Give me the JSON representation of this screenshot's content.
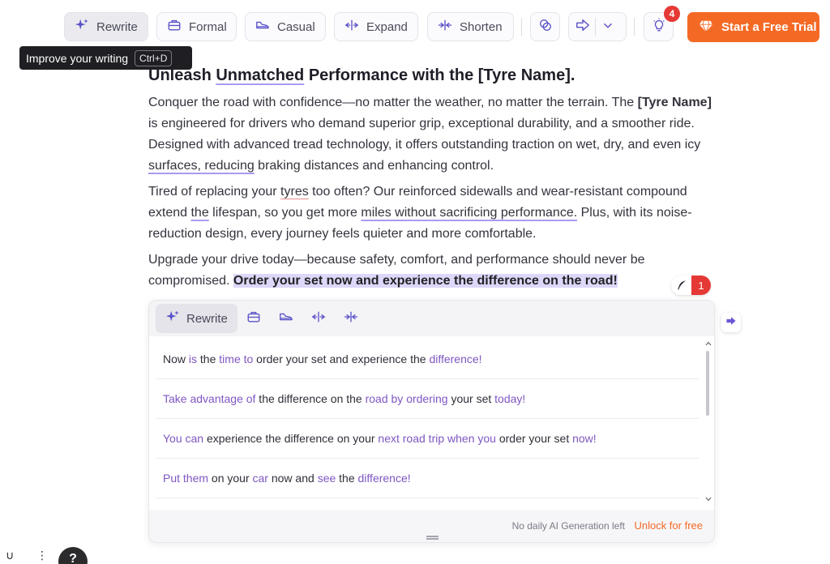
{
  "toolbar": {
    "rewrite_label": "Rewrite",
    "formal_label": "Formal",
    "casual_label": "Casual",
    "expand_label": "Expand",
    "shorten_label": "Shorten",
    "notification_count": "4",
    "trial_label": "Start a Free Trial"
  },
  "tooltip": {
    "text": "Improve your writing",
    "shortcut": "Ctrl+D"
  },
  "document": {
    "heading": {
      "part1": "Unleash ",
      "part2": "Unmatched",
      "part3": " Performance with the [Tyre Name]."
    },
    "para1": {
      "part1": "Conquer the road with confidence—no matter the weather, no matter the terrain. The ",
      "bold": "[Tyre Name]",
      "part2": " is engineered for drivers who demand superior grip, exceptional durability, and a smoother ride. Designed with advanced tread technology, it offers outstanding traction on wet, dry, and even icy ",
      "underlined": "surfaces, reducing",
      "part3": " braking distances and enhancing control."
    },
    "para2": {
      "part1": "Tired of replacing your ",
      "misspelled": "tyres",
      "part2": " too often? Our reinforced sidewalls and wear-resistant compound extend ",
      "underlined1": "the",
      "part3": " lifespan, so you get more ",
      "underlined2": "miles without sacrificing performance.",
      "part4": " Plus, with its noise-reduction design, every journey feels quieter and more comfortable."
    },
    "para3": {
      "part1": "Upgrade your drive today—because safety, comfort, and performance should never be compromised. ",
      "highlighted": "Order your set now and experience the difference on the road!"
    },
    "issue_count": "1"
  },
  "panel": {
    "rewrite_label": "Rewrite",
    "suggestions": [
      [
        {
          "t": "Now ",
          "h": false
        },
        {
          "t": "is",
          "h": true
        },
        {
          "t": " the ",
          "h": false
        },
        {
          "t": "time to",
          "h": true
        },
        {
          "t": " order your set and experience the ",
          "h": false
        },
        {
          "t": "difference!",
          "h": true
        }
      ],
      [
        {
          "t": "Take advantage of",
          "h": true
        },
        {
          "t": " the difference on the ",
          "h": false
        },
        {
          "t": "road by ordering",
          "h": true
        },
        {
          "t": " your set ",
          "h": false
        },
        {
          "t": "today!",
          "h": true
        }
      ],
      [
        {
          "t": "You can",
          "h": true
        },
        {
          "t": " experience the difference on your ",
          "h": false
        },
        {
          "t": "next road trip when you",
          "h": true
        },
        {
          "t": " order your set ",
          "h": false
        },
        {
          "t": "now!",
          "h": true
        }
      ],
      [
        {
          "t": "Put them",
          "h": true
        },
        {
          "t": " on your ",
          "h": false
        },
        {
          "t": "car",
          "h": true
        },
        {
          "t": " now and ",
          "h": false
        },
        {
          "t": "see",
          "h": true
        },
        {
          "t": " the ",
          "h": false
        },
        {
          "t": "difference!",
          "h": true
        }
      ]
    ],
    "footer_note": "No daily AI Generation left",
    "footer_link": "Unlock for free"
  },
  "bottom": {
    "glyph1": "∪",
    "glyph2": "⋮",
    "help_label": "?"
  },
  "colors": {
    "accent_orange": "#f46a25",
    "accent_purple": "#7e57c2",
    "badge_red": "#e53935",
    "highlight": "#ddd7fa"
  }
}
